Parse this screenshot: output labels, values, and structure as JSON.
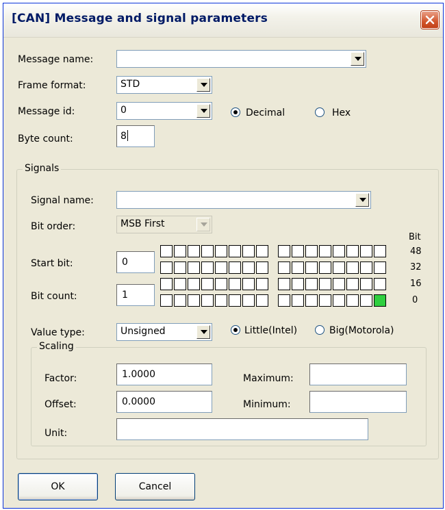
{
  "window": {
    "title": "[CAN] Message and signal parameters",
    "close_icon": "close-icon"
  },
  "message": {
    "name_label": "Message name:",
    "name_value": "",
    "frame_format_label": "Frame format:",
    "frame_format_value": "STD",
    "id_label": "Message id:",
    "id_value": "0",
    "radix_options": [
      "Decimal",
      "Hex"
    ],
    "radix_selected": "Decimal",
    "byte_count_label": "Byte count:",
    "byte_count_value": "8"
  },
  "signals": {
    "group_title": "Signals",
    "name_label": "Signal name:",
    "name_value": "",
    "bit_order_label": "Bit order:",
    "bit_order_value": "MSB First",
    "start_bit_label": "Start bit:",
    "start_bit_value": "0",
    "bit_count_label": "Bit count:",
    "bit_count_value": "1",
    "bit_header": "Bit",
    "bit_row_labels": [
      "48",
      "32",
      "16",
      "0"
    ],
    "highlighted_bit": 0,
    "highlight_color": "#2fcf3f",
    "value_type_label": "Value type:",
    "value_type_value": "Unsigned",
    "endian_options": [
      "Little(Intel)",
      "Big(Motorola)"
    ],
    "endian_selected": "Little(Intel)"
  },
  "scaling": {
    "group_title": "Scaling",
    "factor_label": "Factor:",
    "factor_value": "1.0000",
    "offset_label": "Offset:",
    "offset_value": "0.0000",
    "unit_label": "Unit:",
    "unit_value": "",
    "maximum_label": "Maximum:",
    "maximum_value": "",
    "minimum_label": "Minimum:",
    "minimum_value": ""
  },
  "buttons": {
    "ok": "OK",
    "cancel": "Cancel"
  },
  "colors": {
    "title_text": "#001a66",
    "close_button": "#d2562d",
    "dialog_face": "#ece9d8"
  }
}
